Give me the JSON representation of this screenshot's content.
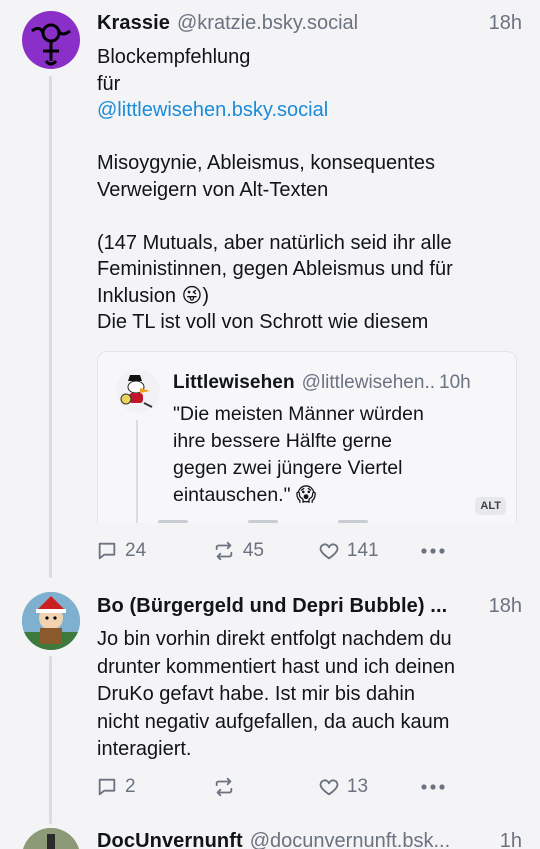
{
  "posts": [
    {
      "author": "Krassie",
      "handle": "@kratzie.bsky.social",
      "time": "18h",
      "lines": [
        "Blockempfehlung",
        "für",
        "@littlewisehen.bsky.social",
        "",
        "Misoygynie, Ableismus, konsequentes",
        "Verweigern von Alt-Texten",
        "",
        "(147 Mutuals, aber natürlich seid ihr alle",
        "Feministinnen, gegen Ableismus und für",
        "Inklusion 😜)",
        "Die TL ist voll von Schrott wie diesem"
      ],
      "quote": {
        "author": "Littlewisehen",
        "handle": "@littlewisehen..",
        "time": "10h",
        "lines": [
          "\"Die meisten Männer würden",
          "ihre bessere Hälfte gerne",
          "gegen zwei jüngere Viertel",
          "eintauschen.\" 😱"
        ],
        "alt_badge": "ALT"
      },
      "replies": "24",
      "reposts": "45",
      "likes": "141"
    },
    {
      "author": "Bo (Bürgergeld und Depri Bubble) ...",
      "handle": "",
      "time": "18h",
      "lines": [
        "Jo bin vorhin direkt entfolgt nachdem du",
        "drunter kommentiert hast und ich deinen",
        "DruKo gefavt habe. Ist mir bis dahin",
        "nicht negativ aufgefallen, da auch kaum",
        "interagiert."
      ],
      "replies": "2",
      "reposts": "",
      "likes": "13"
    },
    {
      "author": "DocUnvernunft",
      "handle": "@docunvernunft.bsk...",
      "time": "1h"
    }
  ],
  "icons": {
    "reply": "speech-bubble-icon",
    "repost": "repost-arrows-icon",
    "like": "heart-icon",
    "more": "more-dots-icon"
  },
  "colors": {
    "mention": "#1a8cd8",
    "muted": "#6b7280",
    "background": "#f4f4f6"
  }
}
